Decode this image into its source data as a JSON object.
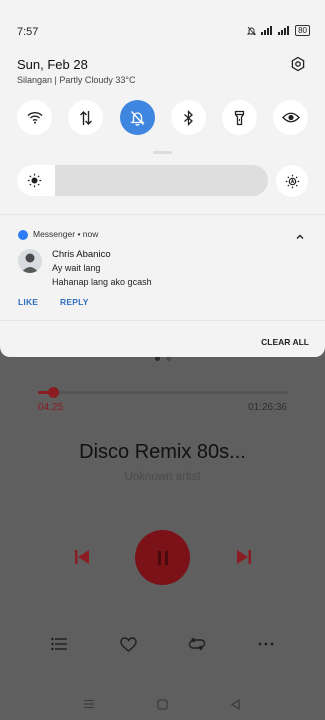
{
  "status_bar": {
    "time": "7:57",
    "battery": "80"
  },
  "header": {
    "date": "Sun, Feb 28",
    "weather": "Silangan | Partly Cloudy 33°C"
  },
  "quick_settings": [
    {
      "name": "wifi",
      "active": false
    },
    {
      "name": "mobile-data",
      "active": false
    },
    {
      "name": "do-not-disturb",
      "active": true
    },
    {
      "name": "bluetooth",
      "active": false
    },
    {
      "name": "flashlight",
      "active": false
    },
    {
      "name": "eye-comfort",
      "active": false
    }
  ],
  "brightness": {
    "level": 0.15
  },
  "notification": {
    "app": "Messenger",
    "when": "now",
    "separator": "•",
    "sender": "Chris Abanico",
    "lines": [
      "Ay wait lang",
      "Hahanap lang ako gcash"
    ],
    "actions": [
      "LIKE",
      "REPLY"
    ]
  },
  "clear_all": "CLEAR ALL",
  "player": {
    "progress": 0.058,
    "current_time": "04:25",
    "total_time": "01:26:36",
    "title": "Disco Remix 80s...",
    "artist": "Unknown artist",
    "accent": "#8b1c22"
  }
}
